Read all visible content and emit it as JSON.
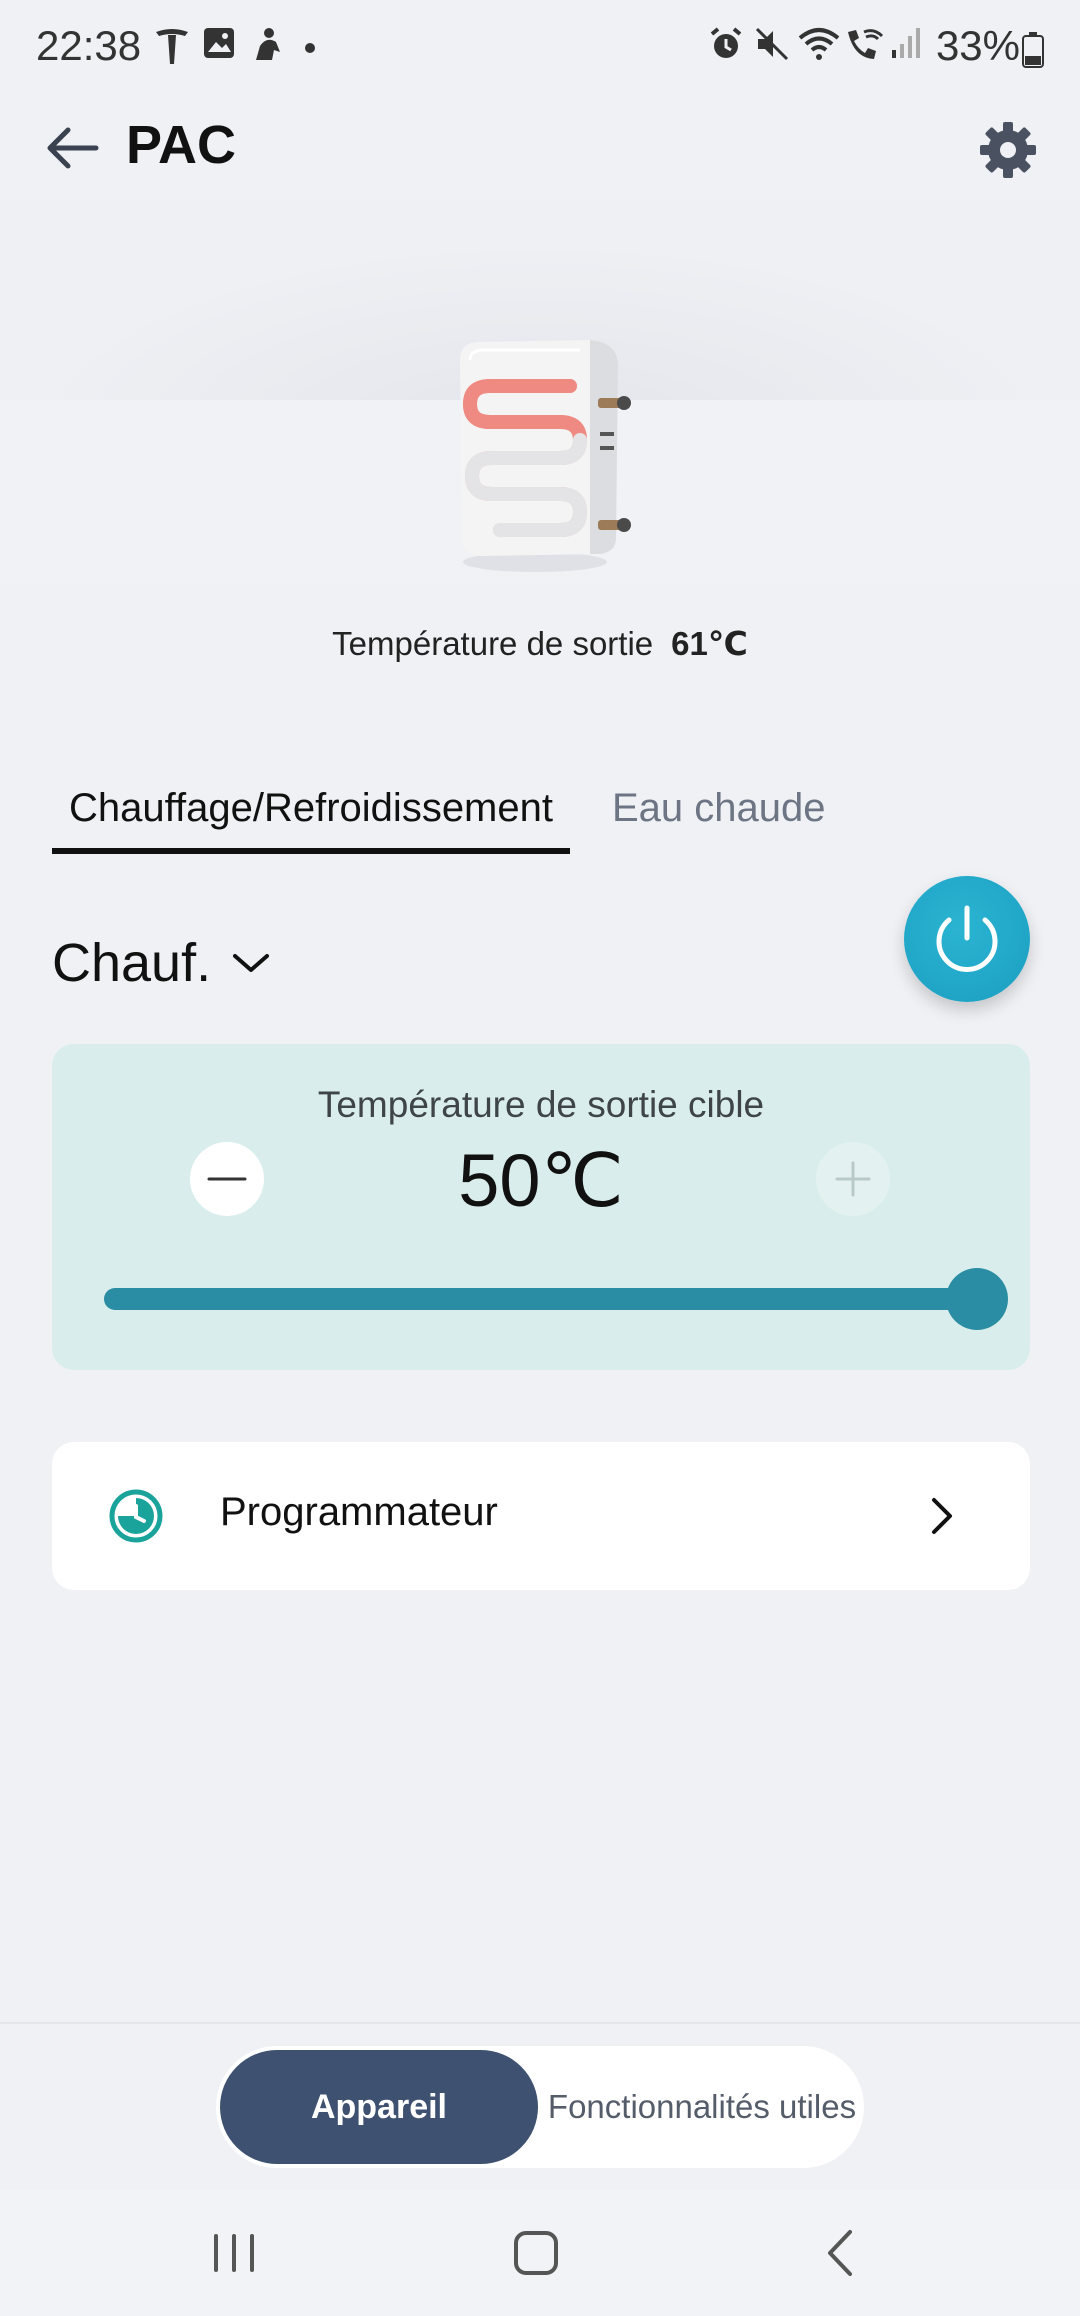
{
  "status_bar": {
    "time": "22:38",
    "battery": "33%",
    "icons": [
      "tesla-icon",
      "gallery-icon",
      "app-icon",
      "dot-icon",
      "alarm-icon",
      "mute-icon",
      "wifi-icon",
      "wifi-call-icon",
      "signal-icon",
      "battery-icon"
    ]
  },
  "header": {
    "title": "PAC"
  },
  "hero": {
    "outlet_label": "Température de sortie",
    "outlet_value": "61℃"
  },
  "tabs": [
    {
      "label": "Chauffage/Refroidissement",
      "active": true
    },
    {
      "label": "Eau chaude",
      "active": false
    }
  ],
  "mode": {
    "label": "Chauf."
  },
  "temperature": {
    "label": "Température de sortie cible",
    "value": "50℃",
    "slider_level": 1.0
  },
  "programmer": {
    "label": "Programmateur"
  },
  "bottom_nav": {
    "device": "Appareil",
    "features": "Fonctionnalités utiles"
  },
  "colors": {
    "accent": "#2b8da3",
    "power": "#1ea7c8",
    "segment_active": "#3e5171",
    "card_bg": "#d9eeec"
  }
}
